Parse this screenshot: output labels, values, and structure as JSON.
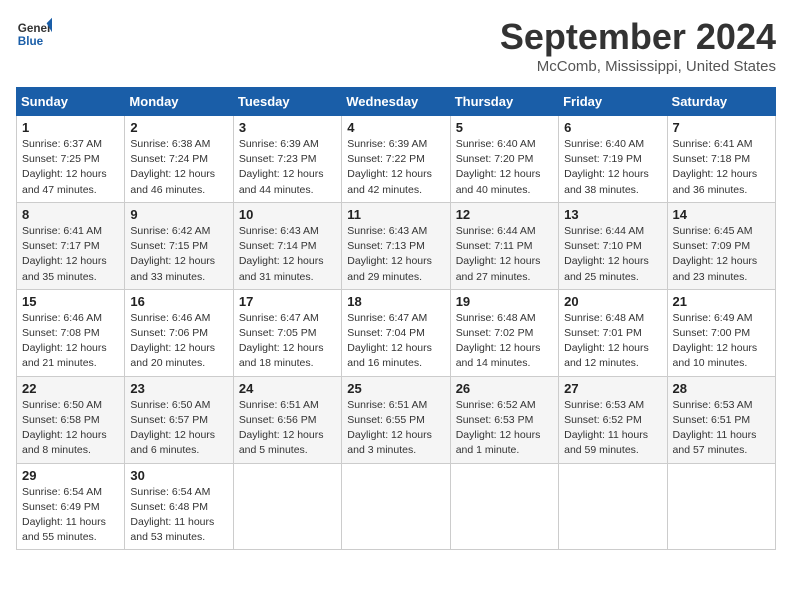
{
  "header": {
    "logo_line1": "General",
    "logo_line2": "Blue",
    "month": "September 2024",
    "location": "McComb, Mississippi, United States"
  },
  "weekdays": [
    "Sunday",
    "Monday",
    "Tuesday",
    "Wednesday",
    "Thursday",
    "Friday",
    "Saturday"
  ],
  "weeks": [
    [
      {
        "day": "1",
        "rise": "6:37 AM",
        "set": "7:25 PM",
        "daylight": "12 hours and 47 minutes."
      },
      {
        "day": "2",
        "rise": "6:38 AM",
        "set": "7:24 PM",
        "daylight": "12 hours and 46 minutes."
      },
      {
        "day": "3",
        "rise": "6:39 AM",
        "set": "7:23 PM",
        "daylight": "12 hours and 44 minutes."
      },
      {
        "day": "4",
        "rise": "6:39 AM",
        "set": "7:22 PM",
        "daylight": "12 hours and 42 minutes."
      },
      {
        "day": "5",
        "rise": "6:40 AM",
        "set": "7:20 PM",
        "daylight": "12 hours and 40 minutes."
      },
      {
        "day": "6",
        "rise": "6:40 AM",
        "set": "7:19 PM",
        "daylight": "12 hours and 38 minutes."
      },
      {
        "day": "7",
        "rise": "6:41 AM",
        "set": "7:18 PM",
        "daylight": "12 hours and 36 minutes."
      }
    ],
    [
      {
        "day": "8",
        "rise": "6:41 AM",
        "set": "7:17 PM",
        "daylight": "12 hours and 35 minutes."
      },
      {
        "day": "9",
        "rise": "6:42 AM",
        "set": "7:15 PM",
        "daylight": "12 hours and 33 minutes."
      },
      {
        "day": "10",
        "rise": "6:43 AM",
        "set": "7:14 PM",
        "daylight": "12 hours and 31 minutes."
      },
      {
        "day": "11",
        "rise": "6:43 AM",
        "set": "7:13 PM",
        "daylight": "12 hours and 29 minutes."
      },
      {
        "day": "12",
        "rise": "6:44 AM",
        "set": "7:11 PM",
        "daylight": "12 hours and 27 minutes."
      },
      {
        "day": "13",
        "rise": "6:44 AM",
        "set": "7:10 PM",
        "daylight": "12 hours and 25 minutes."
      },
      {
        "day": "14",
        "rise": "6:45 AM",
        "set": "7:09 PM",
        "daylight": "12 hours and 23 minutes."
      }
    ],
    [
      {
        "day": "15",
        "rise": "6:46 AM",
        "set": "7:08 PM",
        "daylight": "12 hours and 21 minutes."
      },
      {
        "day": "16",
        "rise": "6:46 AM",
        "set": "7:06 PM",
        "daylight": "12 hours and 20 minutes."
      },
      {
        "day": "17",
        "rise": "6:47 AM",
        "set": "7:05 PM",
        "daylight": "12 hours and 18 minutes."
      },
      {
        "day": "18",
        "rise": "6:47 AM",
        "set": "7:04 PM",
        "daylight": "12 hours and 16 minutes."
      },
      {
        "day": "19",
        "rise": "6:48 AM",
        "set": "7:02 PM",
        "daylight": "12 hours and 14 minutes."
      },
      {
        "day": "20",
        "rise": "6:48 AM",
        "set": "7:01 PM",
        "daylight": "12 hours and 12 minutes."
      },
      {
        "day": "21",
        "rise": "6:49 AM",
        "set": "7:00 PM",
        "daylight": "12 hours and 10 minutes."
      }
    ],
    [
      {
        "day": "22",
        "rise": "6:50 AM",
        "set": "6:58 PM",
        "daylight": "12 hours and 8 minutes."
      },
      {
        "day": "23",
        "rise": "6:50 AM",
        "set": "6:57 PM",
        "daylight": "12 hours and 6 minutes."
      },
      {
        "day": "24",
        "rise": "6:51 AM",
        "set": "6:56 PM",
        "daylight": "12 hours and 5 minutes."
      },
      {
        "day": "25",
        "rise": "6:51 AM",
        "set": "6:55 PM",
        "daylight": "12 hours and 3 minutes."
      },
      {
        "day": "26",
        "rise": "6:52 AM",
        "set": "6:53 PM",
        "daylight": "12 hours and 1 minute."
      },
      {
        "day": "27",
        "rise": "6:53 AM",
        "set": "6:52 PM",
        "daylight": "11 hours and 59 minutes."
      },
      {
        "day": "28",
        "rise": "6:53 AM",
        "set": "6:51 PM",
        "daylight": "11 hours and 57 minutes."
      }
    ],
    [
      {
        "day": "29",
        "rise": "6:54 AM",
        "set": "6:49 PM",
        "daylight": "11 hours and 55 minutes."
      },
      {
        "day": "30",
        "rise": "6:54 AM",
        "set": "6:48 PM",
        "daylight": "11 hours and 53 minutes."
      },
      null,
      null,
      null,
      null,
      null
    ]
  ]
}
